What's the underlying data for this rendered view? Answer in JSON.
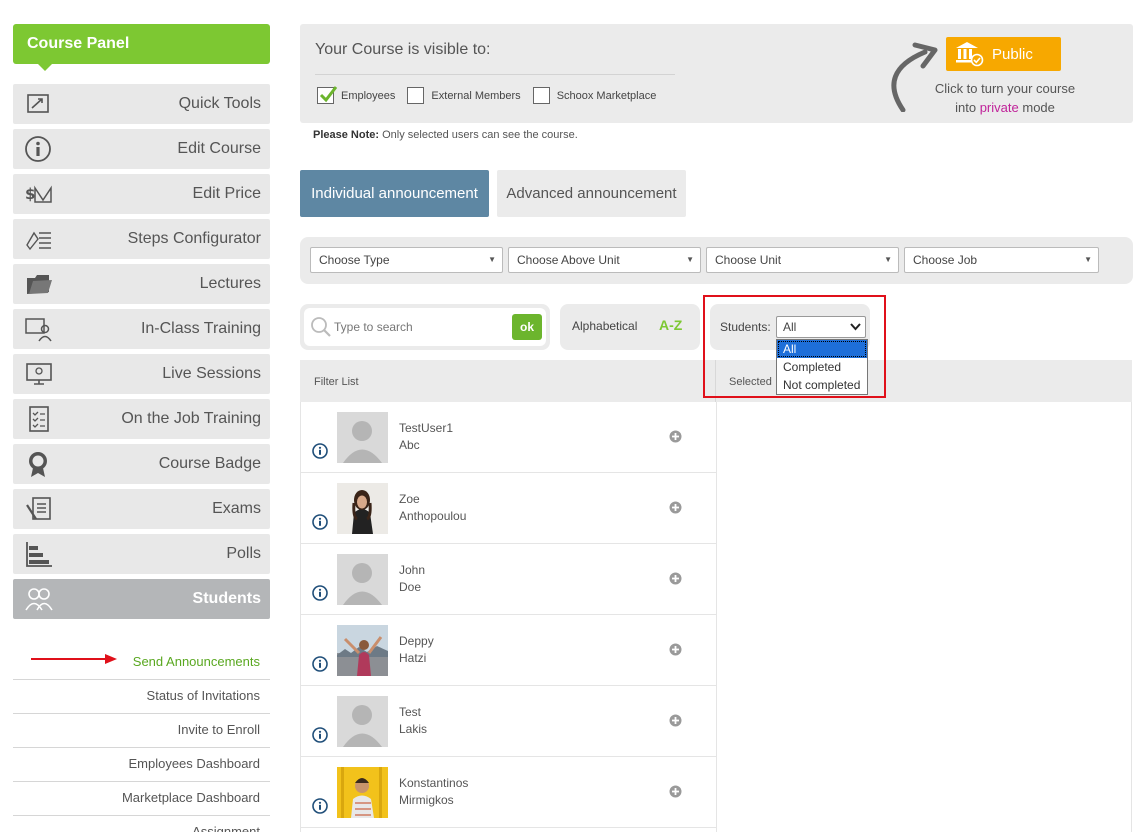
{
  "sidebar": {
    "header": "Course Panel",
    "items": [
      {
        "label": "Quick Tools",
        "icon": "quick-tools-icon"
      },
      {
        "label": "Edit Course",
        "icon": "info-circle-icon"
      },
      {
        "label": "Edit Price",
        "icon": "price-icon"
      },
      {
        "label": "Steps Configurator",
        "icon": "steps-icon"
      },
      {
        "label": "Lectures",
        "icon": "folder-icon"
      },
      {
        "label": "In-Class Training",
        "icon": "classroom-icon"
      },
      {
        "label": "Live Sessions",
        "icon": "monitor-icon"
      },
      {
        "label": "On the Job Training",
        "icon": "checklist-icon"
      },
      {
        "label": "Course Badge",
        "icon": "badge-icon"
      },
      {
        "label": "Exams",
        "icon": "exam-icon"
      },
      {
        "label": "Polls",
        "icon": "poll-chart-icon"
      },
      {
        "label": "Students",
        "icon": "students-icon",
        "active": true
      }
    ],
    "submenu": [
      {
        "label": "Send Announcements",
        "current": true
      },
      {
        "label": "Status of Invitations"
      },
      {
        "label": "Invite to Enroll"
      },
      {
        "label": "Employees Dashboard"
      },
      {
        "label": "Marketplace Dashboard"
      },
      {
        "label": "Assignment"
      }
    ]
  },
  "visibility": {
    "title": "Your Course is visible to:",
    "options": [
      {
        "label": "Employees",
        "checked": true
      },
      {
        "label": "External Members",
        "checked": false
      },
      {
        "label": "Schoox Marketplace",
        "checked": false
      }
    ],
    "public_button": "Public",
    "hint_part1": "Click to turn your course",
    "hint_part2": "into",
    "hint_private": "private",
    "hint_part3": "mode"
  },
  "note": {
    "bold": "Please Note:",
    "text": "Only selected users can see the course."
  },
  "tabs": {
    "individual": "Individual announcement",
    "advanced": "Advanced announcement"
  },
  "filters": [
    "Choose Type",
    "Choose Above Unit",
    "Choose Unit",
    "Choose Job"
  ],
  "search": {
    "placeholder": "Type to search",
    "ok": "ok"
  },
  "sort": {
    "label": "Alphabetical",
    "az": "A-Z"
  },
  "students_filter": {
    "label": "Students:",
    "value": "All",
    "options": [
      "All",
      "Completed",
      "Not completed"
    ]
  },
  "list": {
    "filter_header": "Filter List",
    "selected_header": "Selected",
    "students": [
      {
        "first": "TestUser1",
        "last": "Abc",
        "avatar": "placeholder"
      },
      {
        "first": "Zoe",
        "last": "Anthopoulou",
        "avatar": "photo"
      },
      {
        "first": "John",
        "last": "Doe",
        "avatar": "placeholder"
      },
      {
        "first": "Deppy",
        "last": "Hatzi",
        "avatar": "photo"
      },
      {
        "first": "Test",
        "last": "Lakis",
        "avatar": "placeholder"
      },
      {
        "first": "Konstantinos",
        "last": "Mirmigkos",
        "avatar": "photo"
      }
    ]
  },
  "colors": {
    "accent_green": "#7dc832",
    "tab_blue": "#5e87a3",
    "public_orange": "#f7a800",
    "private_magenta": "#c0239a",
    "highlight_red": "#e0101a"
  }
}
